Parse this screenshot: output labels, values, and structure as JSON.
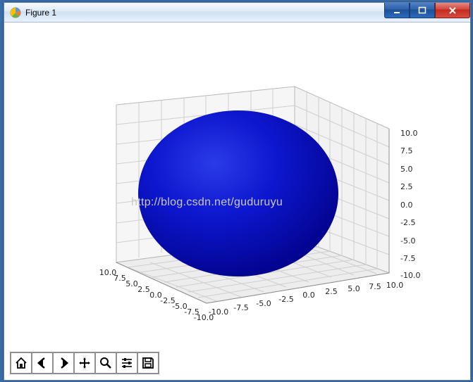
{
  "window": {
    "title": "Figure 1"
  },
  "watermark": "http://blog.csdn.net/guduruyu",
  "toolbar": {
    "home": "Home",
    "back": "Back",
    "forward": "Forward",
    "pan": "Pan",
    "zoom": "Zoom",
    "configure": "Configure subplots",
    "save": "Save"
  },
  "chart_data": {
    "type": "3d-surface",
    "description": "Solid blue sphere of radius 10 centered at origin, rendered on a 3D axes cube",
    "x_ticks": [
      -10.0,
      -7.5,
      -5.0,
      -2.5,
      0.0,
      2.5,
      5.0,
      7.5,
      10.0
    ],
    "y_ticks": [
      -10.0,
      -7.5,
      -5.0,
      -2.5,
      0.0,
      2.5,
      5.0,
      7.5,
      10.0
    ],
    "z_ticks": [
      -10.0,
      -7.5,
      -5.0,
      -2.5,
      0.0,
      2.5,
      5.0,
      7.5,
      10.0
    ],
    "xlim": [
      -10,
      10
    ],
    "ylim": [
      -10,
      10
    ],
    "zlim": [
      -10,
      10
    ],
    "surface": {
      "shape": "sphere",
      "center": [
        0,
        0,
        0
      ],
      "radius": 10,
      "color": "#0707c4"
    },
    "grid": true,
    "elev_deg": 30,
    "azim_deg": -60
  },
  "tick_labels": {
    "x": [
      "10.0",
      "7.5",
      "5.0",
      "2.5",
      "0.0",
      "-2.5",
      "-5.0",
      "-7.5",
      "-10.0"
    ],
    "y": [
      "-10.0",
      "-7.5",
      "-5.0",
      "-2.5",
      "0.0",
      "2.5",
      "5.0",
      "7.5",
      "10.0"
    ],
    "z": [
      "-10.0",
      "-7.5",
      "-5.0",
      "-2.5",
      "0.0",
      "2.5",
      "5.0",
      "7.5",
      "10.0"
    ]
  }
}
